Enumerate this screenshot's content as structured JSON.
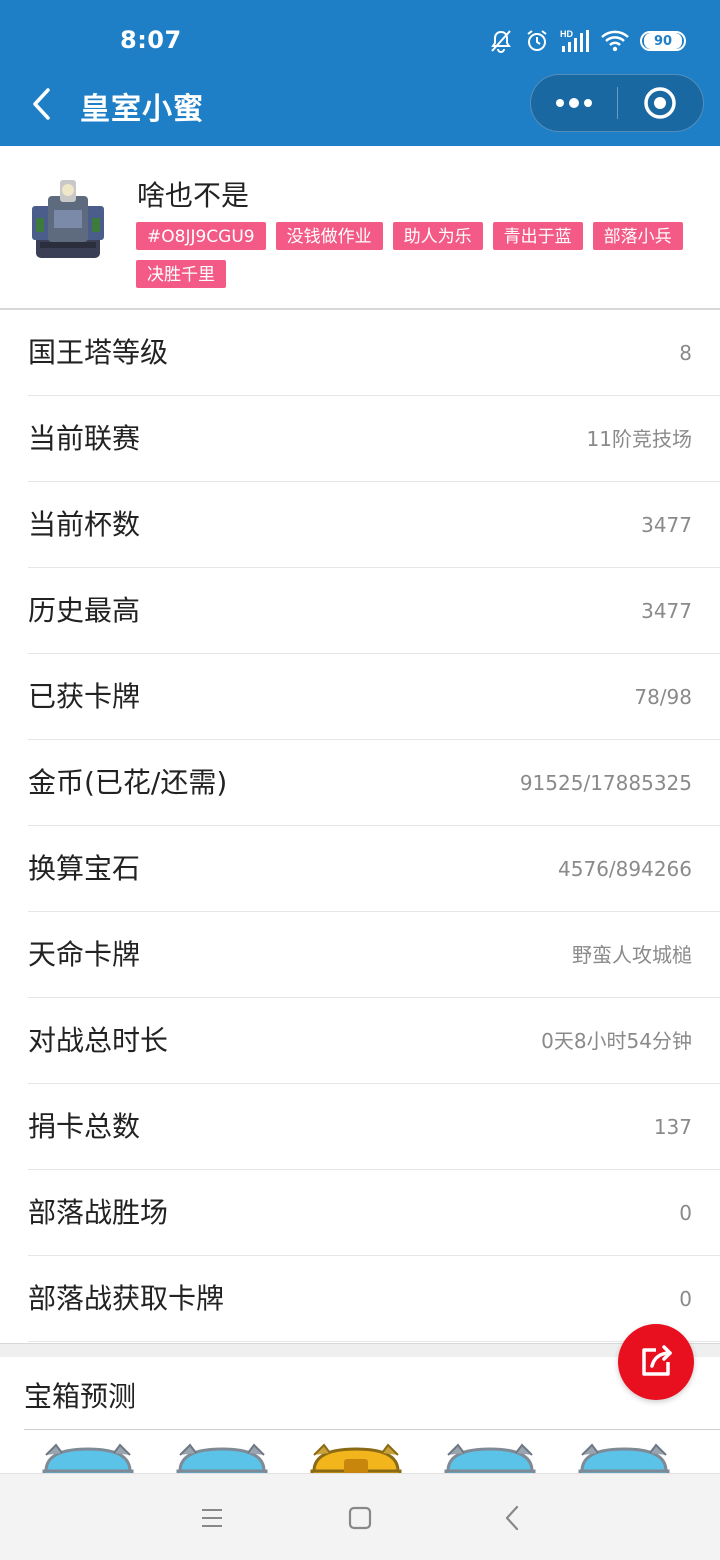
{
  "status_bar": {
    "time": "8:07",
    "network_label": "HD",
    "battery": "90",
    "icons": [
      "mute-icon",
      "alarm-icon",
      "signal-icon",
      "wifi-icon",
      "battery-icon"
    ]
  },
  "header": {
    "title": "皇室小蜜",
    "background_color": "#1f7fc6"
  },
  "profile": {
    "name": "啥也不是",
    "tags": [
      "#O8JJ9CGU9",
      "没钱做作业",
      "助人为乐",
      "青出于蓝",
      "部落小兵",
      "决胜千里"
    ],
    "tag_color": "#f35b86"
  },
  "stats": [
    {
      "label": "国王塔等级",
      "value": "8"
    },
    {
      "label": "当前联赛",
      "value": "11阶竞技场"
    },
    {
      "label": "当前杯数",
      "value": "3477"
    },
    {
      "label": "历史最高",
      "value": "3477"
    },
    {
      "label": "已获卡牌",
      "value": "78/98"
    },
    {
      "label": "金币(已花/还需)",
      "value": "91525/17885325"
    },
    {
      "label": "换算宝石",
      "value": "4576/894266"
    },
    {
      "label": "天命卡牌",
      "value": "野蛮人攻城槌"
    },
    {
      "label": "对战总时长",
      "value": "0天8小时54分钟"
    },
    {
      "label": "捐卡总数",
      "value": "137"
    },
    {
      "label": "部落战胜场",
      "value": "0"
    },
    {
      "label": "部落战获取卡牌",
      "value": "0"
    }
  ],
  "chest_prediction": {
    "title": "宝箱预测",
    "chests": [
      "silver-chest",
      "silver-chest",
      "golden-chest",
      "silver-chest",
      "silver-chest"
    ]
  },
  "share_button": {
    "icon": "share-icon",
    "color": "#e8101f"
  }
}
